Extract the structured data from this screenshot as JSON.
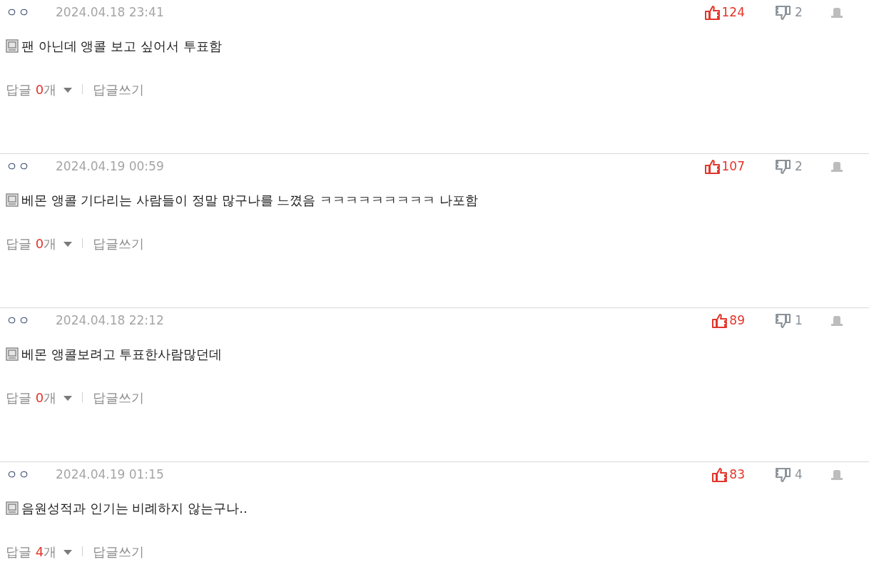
{
  "comments": [
    {
      "author": "ㅇㅇ",
      "date": "2024.04.18 23:41",
      "text": "팬 아닌데 앵콜 보고 싶어서 투표함",
      "likes": "124",
      "dislikes": "2",
      "reply_label": "답글",
      "reply_count": "0",
      "reply_unit": "개",
      "write_reply": "답글쓰기"
    },
    {
      "author": "ㅇㅇ",
      "date": "2024.04.19 00:59",
      "text": "베몬 앵콜 기다리는 사람들이 정말 많구나를 느꼈음 ㅋㅋㅋㅋㅋㅋㅋㅋㅋ 나포함",
      "likes": "107",
      "dislikes": "2",
      "reply_label": "답글",
      "reply_count": "0",
      "reply_unit": "개",
      "write_reply": "답글쓰기"
    },
    {
      "author": "ㅇㅇ",
      "date": "2024.04.18 22:12",
      "text": "베몬 앵콜보려고 투표한사람많던데",
      "likes": "89",
      "dislikes": "1",
      "reply_label": "답글",
      "reply_count": "0",
      "reply_unit": "개",
      "write_reply": "답글쓰기"
    },
    {
      "author": "ㅇㅇ",
      "date": "2024.04.19 01:15",
      "text": "음원성적과 인기는 비례하지 않는구나..",
      "likes": "83",
      "dislikes": "4",
      "reply_label": "답글",
      "reply_count": "4",
      "reply_unit": "개",
      "write_reply": "답글쓰기"
    }
  ]
}
